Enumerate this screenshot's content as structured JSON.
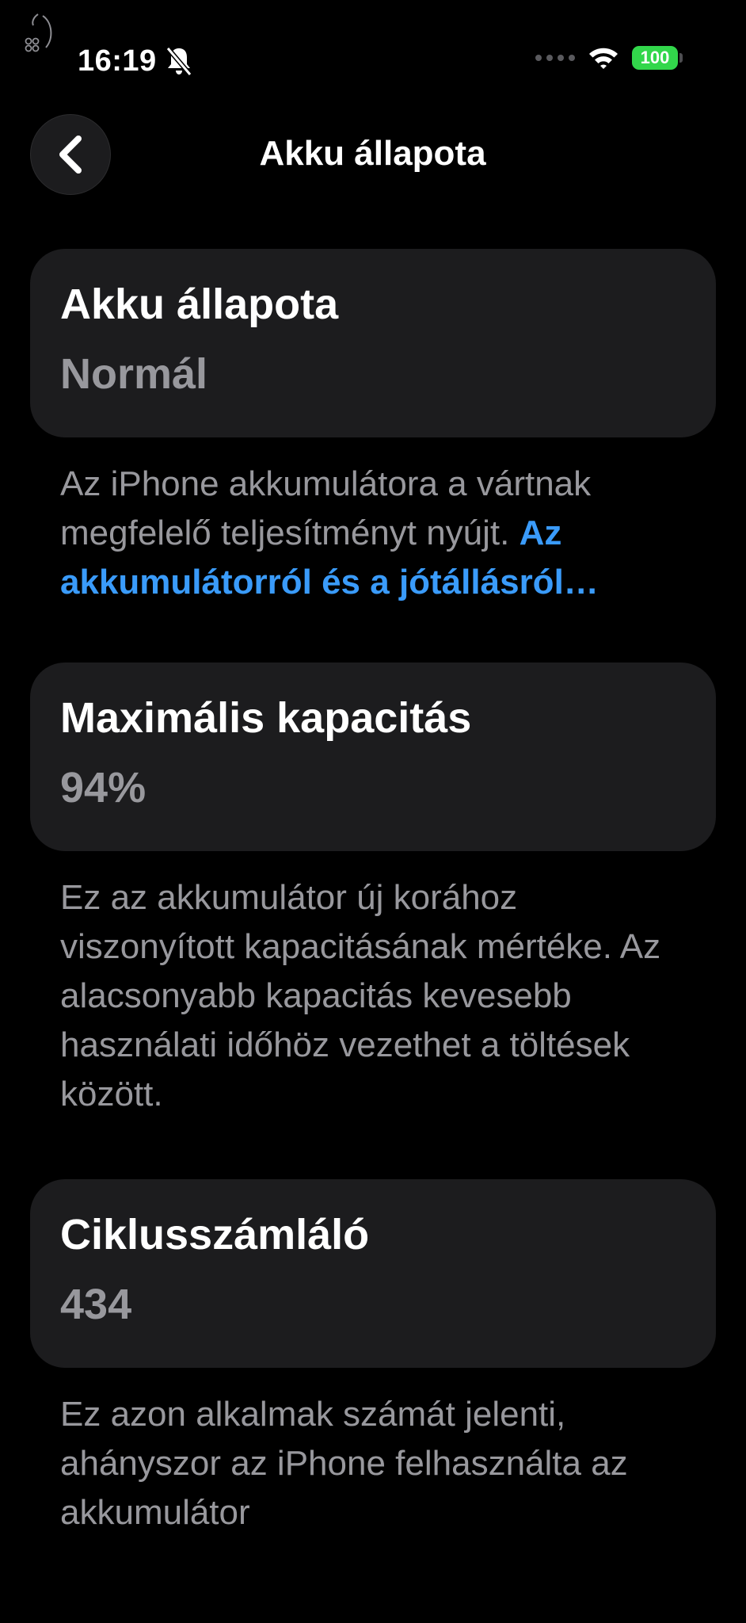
{
  "status_bar": {
    "time": "16:19",
    "battery_level": "100",
    "battery_color": "#32d74b"
  },
  "nav": {
    "title": "Akku állapota",
    "back_icon": "chevron-left-icon"
  },
  "cards": [
    {
      "label": "Akku állapota",
      "value": "Normál"
    },
    {
      "label": "Maximális kapacitás",
      "value": "94%"
    },
    {
      "label": "Ciklusszámláló",
      "value": "434"
    }
  ],
  "footnotes": {
    "health_text": "Az iPhone akkumulátora a vártnak megfelelő teljesítményt nyújt. ",
    "health_link": "Az akkumulátorról és a jótállásról…",
    "capacity_text": "Ez az akkumulátor új korához viszonyított kapacitásának mértéke. Az alacsonyabb kapacitás kevesebb használati időhöz vezethet a töltések között.",
    "cycle_text": "Ez azon alkalmak számát jelenti, ahányszor az iPhone felhasználta az akkumulátor"
  },
  "colors": {
    "background": "#000000",
    "card": "#1c1c1e",
    "secondary_text": "#98989d",
    "link": "#3a9bfa"
  }
}
